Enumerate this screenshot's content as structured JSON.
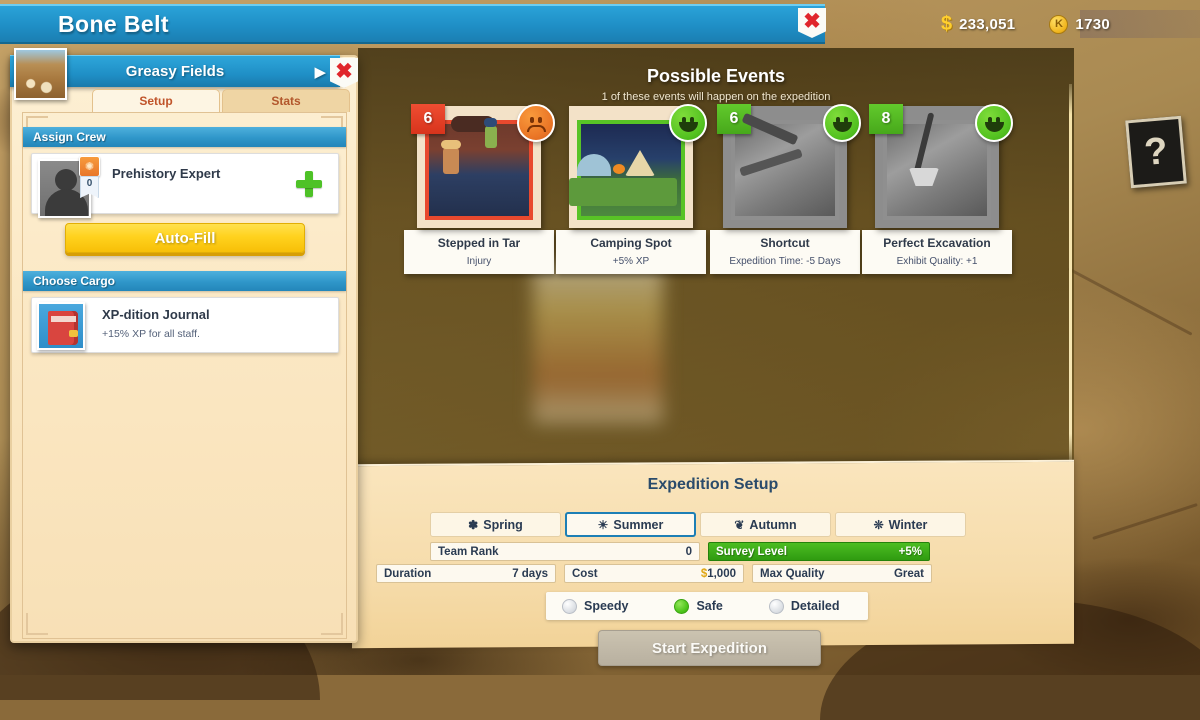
{
  "header": {
    "title": "Bone Belt",
    "close_icon": "close-x-icon",
    "currency": [
      {
        "icon": "dollar-coin-icon",
        "glyph": "$",
        "value": "233,051"
      },
      {
        "icon": "knowledge-coin-icon",
        "glyph": "K",
        "value": "1730"
      }
    ]
  },
  "sidebar": {
    "location_title": "Greasy Fields",
    "prev_arrow": "◀",
    "next_arrow": "▶",
    "close_icon": "close-x-icon",
    "thumbnail_name": "location-thumbnail",
    "tabs": [
      {
        "label": "Setup",
        "active": true
      },
      {
        "label": "Stats",
        "active": false
      }
    ],
    "assign_crew": {
      "header": "Assign Crew",
      "slot": {
        "role": "Prehistory Expert",
        "level": "0",
        "add_label": "+"
      }
    },
    "autofill_label": "Auto-Fill",
    "choose_cargo": {
      "header": "Choose Cargo",
      "item": {
        "name": "XP-dition Journal",
        "description": "+15% XP for all staff."
      }
    }
  },
  "events": {
    "title": "Possible Events",
    "subtitle": "1 of these events will happen on the expedition",
    "cards": [
      {
        "badge": "6",
        "badge_color": "red",
        "mood": "sad",
        "style": "red",
        "name": "Stepped in Tar",
        "effect": "Injury"
      },
      {
        "badge": "",
        "badge_color": "none",
        "mood": "happy",
        "style": "green",
        "name": "Camping Spot",
        "effect": "+5% XP"
      },
      {
        "badge": "6",
        "badge_color": "green",
        "mood": "happy",
        "style": "grey",
        "name": "Shortcut",
        "effect": "Expedition Time: -5 Days"
      },
      {
        "badge": "8",
        "badge_color": "green",
        "mood": "happy",
        "style": "grey",
        "name": "Perfect Excavation",
        "effect": "Exhibit Quality: +1"
      }
    ]
  },
  "setup": {
    "title": "Expedition Setup",
    "seasons": [
      {
        "label": "Spring",
        "icon": "flower-icon",
        "glyph": "✽",
        "selected": false
      },
      {
        "label": "Summer",
        "icon": "sun-icon",
        "glyph": "☀",
        "selected": true
      },
      {
        "label": "Autumn",
        "icon": "leaf-icon",
        "glyph": "❦",
        "selected": false
      },
      {
        "label": "Winter",
        "icon": "snowflake-icon",
        "glyph": "❊",
        "selected": false
      }
    ],
    "team_rank": {
      "label": "Team Rank",
      "value": "0"
    },
    "survey_level": {
      "label": "Survey Level",
      "value": "+5%"
    },
    "duration": {
      "label": "Duration",
      "value": "7 days"
    },
    "cost": {
      "label": "Cost",
      "currency_glyph": "$",
      "value": "1,000"
    },
    "max_quality": {
      "label": "Max Quality",
      "value": "Great"
    },
    "modes": [
      {
        "label": "Speedy",
        "selected": false
      },
      {
        "label": "Safe",
        "selected": true
      },
      {
        "label": "Detailed",
        "selected": false
      }
    ],
    "start_button": "Start Expedition"
  },
  "map": {
    "mystery_card_glyph": "?"
  },
  "colors": {
    "accent_blue": "#1f8fc6",
    "panel_cream": "#fbe8c4",
    "good_green": "#4cc41a",
    "bad_red": "#e8492e",
    "gold": "#ffd21e"
  }
}
